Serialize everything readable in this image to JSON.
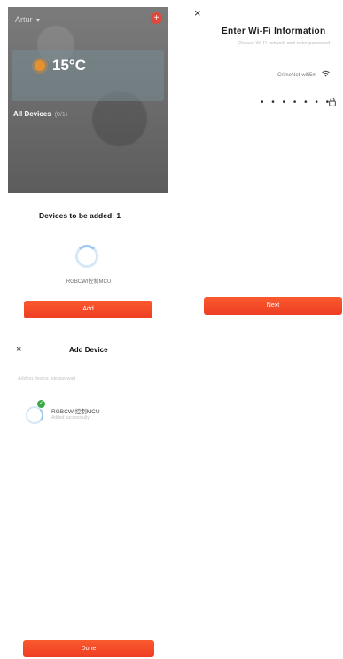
{
  "home": {
    "user": "Artur",
    "temperature": "15°C",
    "section": "All Devices",
    "section_sub": "(0/1)"
  },
  "pending": {
    "title": "Devices to be added: 1",
    "device_label": "RGBCWI控制MCU",
    "add_label": "Add"
  },
  "wifi": {
    "title": "Enter Wi-Fi Information",
    "hint": "Choose Wi-Fi network and enter password",
    "ssid": "CrimeNet-wifi5m",
    "password_mask": "• • • • • • •",
    "next_label": "Next"
  },
  "add_device": {
    "title": "Add Device",
    "hint": "Adding device, please wait",
    "device_name": "RGBCWI控制MCU",
    "device_status": "Added successfully",
    "done_label": "Done"
  },
  "colors": {
    "accent": "#ee3d23",
    "success": "#3aa845",
    "spinner": "#9bc7ec"
  }
}
